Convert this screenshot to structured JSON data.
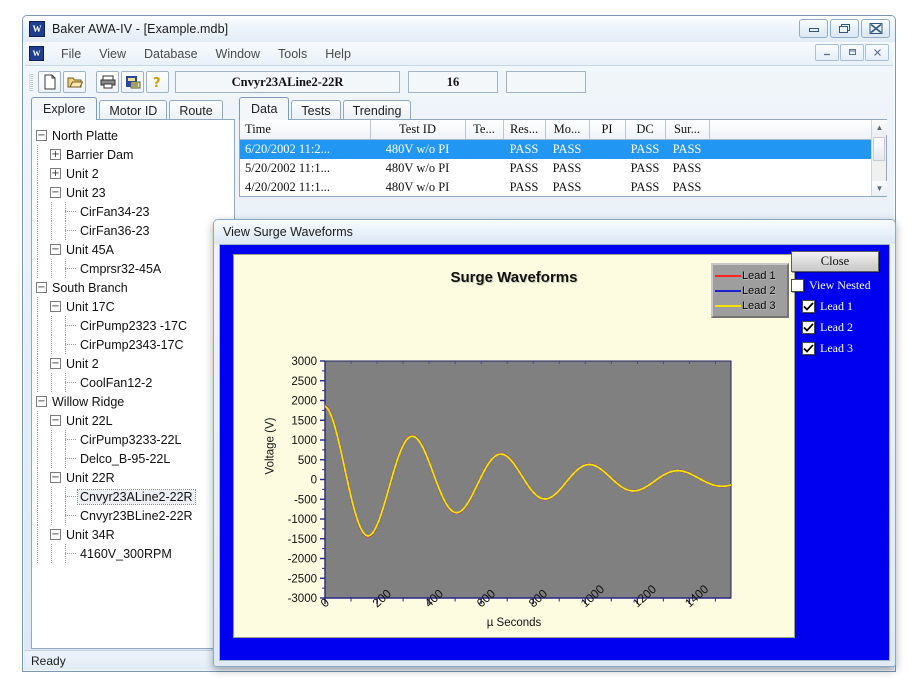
{
  "app": {
    "title": "Baker AWA-IV - [Example.mdb]",
    "logo_text": "W",
    "status": "Ready",
    "window_buttons": {
      "minimize": "minimize-icon",
      "restore": "restore-icon",
      "close": "close-icon"
    },
    "mdi_buttons": {
      "minimize": "minimize-icon",
      "restore": "restore-icon",
      "close": "close-icon"
    }
  },
  "menu": {
    "items": [
      "File",
      "View",
      "Database",
      "Window",
      "Tools",
      "Help"
    ]
  },
  "toolbar": {
    "buttons": [
      "new-document-icon",
      "open-folder-icon",
      "print-icon",
      "database-report-icon",
      "help-question-icon"
    ],
    "motor_field": "Cnvyr23ALine2-22R",
    "count_field": "16",
    "blank_field": ""
  },
  "left_tabs": {
    "items": [
      "Explore",
      "Motor ID",
      "Route"
    ],
    "active": "Explore"
  },
  "right_tabs": {
    "items": [
      "Data",
      "Tests",
      "Trending"
    ],
    "active": "Data"
  },
  "tree": {
    "nodes": [
      {
        "label": "North Platte",
        "depth": 0,
        "toggle": "minus",
        "selected": false
      },
      {
        "label": "Barrier Dam",
        "depth": 1,
        "toggle": "plus",
        "selected": false
      },
      {
        "label": "Unit 2",
        "depth": 1,
        "toggle": "plus",
        "selected": false
      },
      {
        "label": "Unit 23",
        "depth": 1,
        "toggle": "minus",
        "selected": false
      },
      {
        "label": "CirFan34-23",
        "depth": 2,
        "toggle": "leaf",
        "selected": false
      },
      {
        "label": "CirFan36-23",
        "depth": 2,
        "toggle": "leaf",
        "selected": false
      },
      {
        "label": "Unit 45A",
        "depth": 1,
        "toggle": "minus",
        "selected": false
      },
      {
        "label": "Cmprsr32-45A",
        "depth": 2,
        "toggle": "leaf",
        "selected": false
      },
      {
        "label": "South Branch",
        "depth": 0,
        "toggle": "minus",
        "selected": false
      },
      {
        "label": "Unit 17C",
        "depth": 1,
        "toggle": "minus",
        "selected": false
      },
      {
        "label": "CirPump2323 -17C",
        "depth": 2,
        "toggle": "leaf",
        "selected": false
      },
      {
        "label": "CirPump2343-17C",
        "depth": 2,
        "toggle": "leaf",
        "selected": false
      },
      {
        "label": "Unit 2",
        "depth": 1,
        "toggle": "minus",
        "selected": false
      },
      {
        "label": "CoolFan12-2",
        "depth": 2,
        "toggle": "leaf",
        "selected": false
      },
      {
        "label": "Willow Ridge",
        "depth": 0,
        "toggle": "minus",
        "selected": false
      },
      {
        "label": "Unit 22L",
        "depth": 1,
        "toggle": "minus",
        "selected": false
      },
      {
        "label": "CirPump3233-22L",
        "depth": 2,
        "toggle": "leaf",
        "selected": false
      },
      {
        "label": "Delco_B-95-22L",
        "depth": 2,
        "toggle": "leaf",
        "selected": false
      },
      {
        "label": "Unit 22R",
        "depth": 1,
        "toggle": "minus",
        "selected": false
      },
      {
        "label": "Cnvyr23ALine2-22R",
        "depth": 2,
        "toggle": "leaf",
        "selected": true
      },
      {
        "label": "Cnvyr23BLine2-22R",
        "depth": 2,
        "toggle": "leaf",
        "selected": false
      },
      {
        "label": "Unit 34R",
        "depth": 1,
        "toggle": "minus",
        "selected": false
      },
      {
        "label": "4160V_300RPM",
        "depth": 2,
        "toggle": "leaf",
        "selected": false
      }
    ]
  },
  "grid": {
    "columns": [
      "Time",
      "Test ID",
      "Te...",
      "Res...",
      "Mo...",
      "PI",
      "DC",
      "Sur...",
      ""
    ],
    "rows": [
      {
        "selected": true,
        "cells": [
          "6/20/2002 11:2...",
          "480V w/o PI",
          "",
          "PASS",
          "PASS",
          "",
          "PASS",
          "PASS",
          ""
        ]
      },
      {
        "selected": false,
        "cells": [
          "5/20/2002 11:1...",
          "480V w/o PI",
          "",
          "PASS",
          "PASS",
          "",
          "PASS",
          "PASS",
          ""
        ]
      },
      {
        "selected": false,
        "cells": [
          "4/20/2002 11:1...",
          "480V w/o PI",
          "",
          "PASS",
          "PASS",
          "",
          "PASS",
          "PASS",
          ""
        ]
      }
    ]
  },
  "dialog": {
    "title": "View Surge Waveforms",
    "close_label": "Close",
    "background_color": "#0000f0",
    "checkboxes": [
      {
        "label": "View Nested",
        "checked": false,
        "indent": false
      },
      {
        "label": "Lead 1",
        "checked": true,
        "indent": true
      },
      {
        "label": "Lead 2",
        "checked": true,
        "indent": true
      },
      {
        "label": "Lead 3",
        "checked": true,
        "indent": true
      }
    ]
  },
  "chart_data": {
    "type": "line",
    "title": "Surge Waveforms",
    "xlabel": "µ Seconds",
    "ylabel": "Voltage (V)",
    "xlim": [
      0,
      1560
    ],
    "ylim": [
      -3000,
      3000
    ],
    "xticks": [
      0,
      200,
      400,
      600,
      800,
      1000,
      1200,
      1400
    ],
    "yticks": [
      3000,
      2500,
      2000,
      1500,
      1000,
      500,
      0,
      -500,
      -1000,
      -1500,
      -2000,
      -2500,
      -3000
    ],
    "grid": false,
    "plot_bg_color": "#808080",
    "panel_bg_color": "#fdfbe0",
    "legend_position": "top-right",
    "legend": [
      "Lead 1",
      "Lead 2",
      "Lead 3"
    ],
    "series": [
      {
        "name": "Lead 1",
        "color": "#ff2020",
        "amplitude0": 1870,
        "decay_tau": 640,
        "period": 340,
        "phase_deg": 0
      },
      {
        "name": "Lead 2",
        "color": "#2020d0",
        "amplitude0": 1860,
        "decay_tau": 640,
        "period": 340,
        "phase_deg": 0
      },
      {
        "name": "Lead 3",
        "color": "#f4e400",
        "amplitude0": 1855,
        "decay_tau": 640,
        "period": 340,
        "phase_deg": 0
      }
    ],
    "key_points": {
      "x": [
        0,
        160,
        330,
        500,
        670,
        840,
        1010,
        1180,
        1350,
        1530
      ],
      "y": [
        1870,
        -1570,
        1400,
        -1150,
        1030,
        -860,
        790,
        -650,
        600,
        -330
      ]
    }
  }
}
